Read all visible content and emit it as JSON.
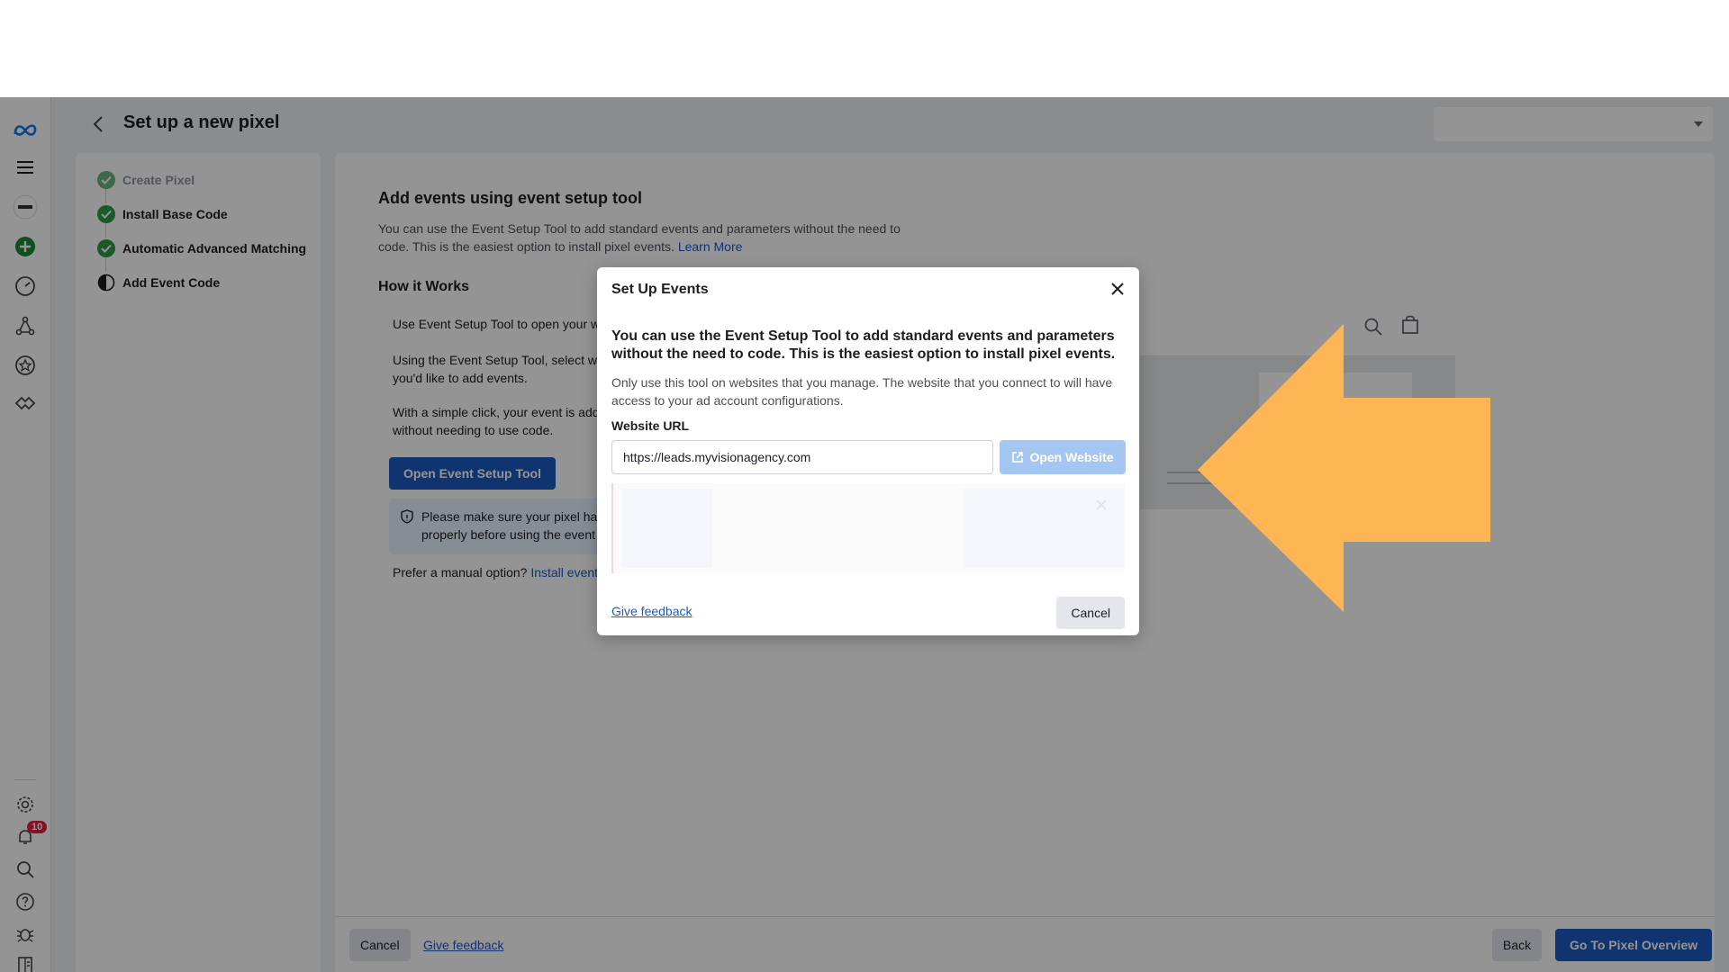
{
  "page": {
    "title": "Set up a new pixel",
    "account_select": ""
  },
  "rail": {
    "notification_count": "10"
  },
  "steps": [
    {
      "label": "Create Pixel",
      "state": "done-muted"
    },
    {
      "label": "Install Base Code",
      "state": "done"
    },
    {
      "label": "Automatic Advanced Matching",
      "state": "done"
    },
    {
      "label": "Add Event Code",
      "state": "in-progress"
    }
  ],
  "main": {
    "heading": "Add events using event setup tool",
    "intro_line1": "You can use the Event Setup Tool to add standard events and parameters without the need to",
    "intro_line2": "code. This is the easiest option to install pixel events.",
    "learn_more": "Learn More",
    "how_title": "How it Works",
    "how_1": "Use Event Setup Tool to open your w",
    "how_2a": "Using the Event Setup Tool, select wh",
    "how_2b": "you'd like to add events.",
    "how_3a": "With a simple click, your event is add",
    "how_3b": "without needing to use code.",
    "open_tool_button": "Open Event Setup Tool",
    "notice_line1": "Please make sure your pixel has",
    "notice_line2": "properly before using the event",
    "manual_prefix": "Prefer a manual option?",
    "manual_link": "Install event"
  },
  "footer": {
    "cancel": "Cancel",
    "feedback": "Give feedback",
    "back": "Back",
    "overview": "Go To Pixel Overview"
  },
  "modal": {
    "title": "Set Up Events",
    "headline": "You can use the Event Setup Tool to add standard events and parameters without the need to code. This is the easiest option to install pixel events.",
    "body": "Only use this tool on websites that you manage. The website that you connect to will have access to your ad account configurations.",
    "url_label": "Website URL",
    "url_value": "https://leads.myvisionagency.com",
    "open_website": "Open Website",
    "feedback": "Give feedback",
    "cancel": "Cancel"
  },
  "colors": {
    "accent": "#1a5bc2",
    "success": "#2e9b48",
    "annotation_arrow": "#fdb653"
  }
}
